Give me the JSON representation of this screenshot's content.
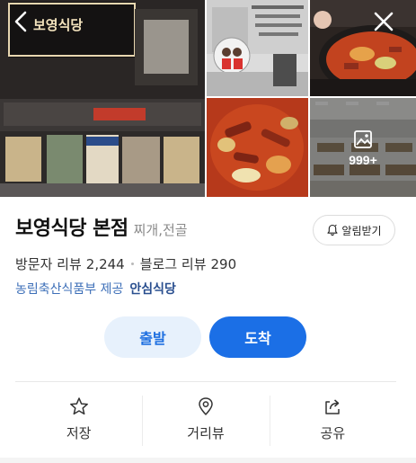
{
  "gallery": {
    "storefront_sign": "보영식당",
    "more_count": "999+"
  },
  "place": {
    "name": "보영식당 본점",
    "category": "찌개,전골"
  },
  "alarm": {
    "label": "알림받기"
  },
  "stats": {
    "visitor_review_label": "방문자 리뷰",
    "visitor_review_count": "2,244",
    "blog_review_label": "블로그 리뷰",
    "blog_review_count": "290"
  },
  "certification": {
    "label": "농림축산식품부 제공",
    "badge": "안심식당"
  },
  "route": {
    "start_label": "출발",
    "arrive_label": "도착"
  },
  "actions": [
    {
      "label": "저장",
      "icon": "star-icon"
    },
    {
      "label": "거리뷰",
      "icon": "location-pin-icon"
    },
    {
      "label": "공유",
      "icon": "share-icon"
    }
  ],
  "colors": {
    "primary": "#1b6fe6",
    "primary_light": "#e7f1fc",
    "certification": "#3d6fb8"
  }
}
